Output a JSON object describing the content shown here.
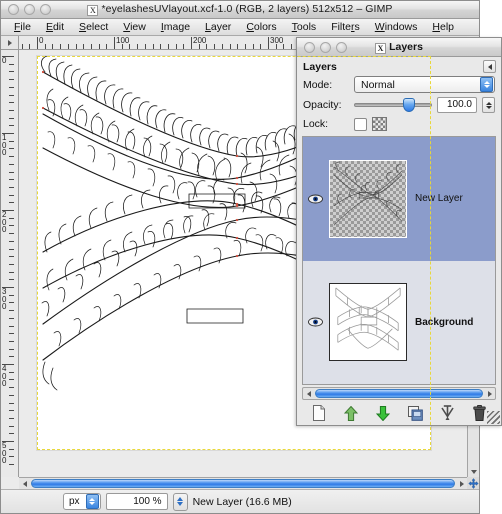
{
  "image_window": {
    "title": "*eyelashesUVlayout.xcf-1.0 (RGB, 2 layers) 512x512 – GIMP",
    "title_icon": "X",
    "menus": [
      {
        "label": "File"
      },
      {
        "label": "Edit"
      },
      {
        "label": "Select"
      },
      {
        "label": "View"
      },
      {
        "label": "Image"
      },
      {
        "label": "Layer"
      },
      {
        "label": "Colors"
      },
      {
        "label": "Tools"
      },
      {
        "label": "Filters"
      },
      {
        "label": "Windows"
      },
      {
        "label": "Help"
      }
    ],
    "rulers": {
      "unit": "px",
      "horizontal_labels": [
        "0",
        "100",
        "200",
        "300"
      ],
      "vertical_labels": [
        "0",
        "100",
        "200",
        "300",
        "400",
        "500"
      ]
    },
    "statusbar": {
      "unit": "px",
      "zoom": "100 %",
      "info": "New Layer (16.6 MB)"
    }
  },
  "layers_dialog": {
    "window_title": "Layers",
    "window_title_icon": "X",
    "tab_title": "Layers",
    "menu_button_icon": "left-triangle-icon",
    "mode_label": "Mode:",
    "mode_value": "Normal",
    "opacity_label": "Opacity:",
    "opacity_value": "100.0",
    "opacity_percent": 100,
    "lock_label": "Lock:",
    "lock_alpha_icon": "checkerboard-icon",
    "layers": [
      {
        "name": "New Layer",
        "visible": true,
        "selected": true,
        "thumbnail": "transparent-strokes"
      },
      {
        "name": "Background",
        "visible": true,
        "selected": false,
        "thumbnail": "white-uv-outline"
      }
    ],
    "toolbar_buttons": [
      {
        "name": "new-layer-button",
        "icon": "page-icon"
      },
      {
        "name": "raise-layer-button",
        "icon": "up-arrow-icon"
      },
      {
        "name": "lower-layer-button",
        "icon": "down-arrow-icon"
      },
      {
        "name": "duplicate-layer-button",
        "icon": "duplicate-icon"
      },
      {
        "name": "anchor-layer-button",
        "icon": "anchor-icon"
      },
      {
        "name": "delete-layer-button",
        "icon": "trash-icon"
      }
    ]
  },
  "colors": {
    "selected_row": "#8b9ccb",
    "list_background": "#dde0e8",
    "chrome": "#e9e9e9",
    "layer_boundary": "#e8d83a",
    "scroll_blue": "#2f7ae6"
  }
}
